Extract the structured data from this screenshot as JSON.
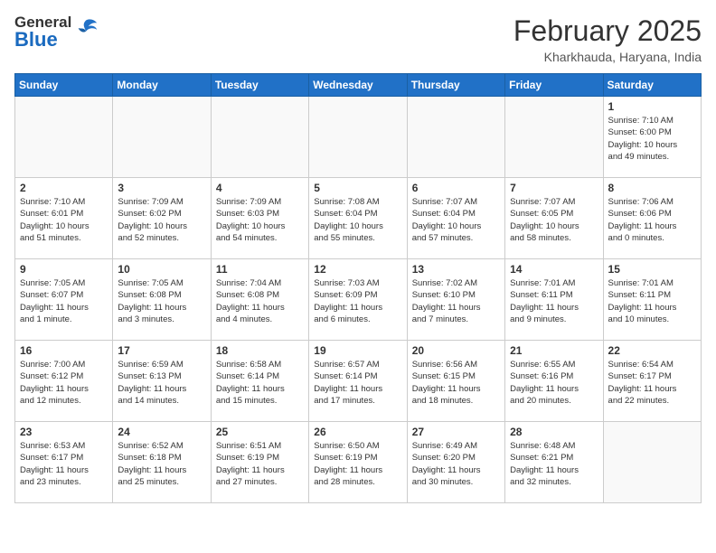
{
  "header": {
    "logo_general": "General",
    "logo_blue": "Blue",
    "month_title": "February 2025",
    "location": "Kharkhauda, Haryana, India"
  },
  "weekdays": [
    "Sunday",
    "Monday",
    "Tuesday",
    "Wednesday",
    "Thursday",
    "Friday",
    "Saturday"
  ],
  "weeks": [
    [
      {
        "day": "",
        "info": ""
      },
      {
        "day": "",
        "info": ""
      },
      {
        "day": "",
        "info": ""
      },
      {
        "day": "",
        "info": ""
      },
      {
        "day": "",
        "info": ""
      },
      {
        "day": "",
        "info": ""
      },
      {
        "day": "1",
        "info": "Sunrise: 7:10 AM\nSunset: 6:00 PM\nDaylight: 10 hours\nand 49 minutes."
      }
    ],
    [
      {
        "day": "2",
        "info": "Sunrise: 7:10 AM\nSunset: 6:01 PM\nDaylight: 10 hours\nand 51 minutes."
      },
      {
        "day": "3",
        "info": "Sunrise: 7:09 AM\nSunset: 6:02 PM\nDaylight: 10 hours\nand 52 minutes."
      },
      {
        "day": "4",
        "info": "Sunrise: 7:09 AM\nSunset: 6:03 PM\nDaylight: 10 hours\nand 54 minutes."
      },
      {
        "day": "5",
        "info": "Sunrise: 7:08 AM\nSunset: 6:04 PM\nDaylight: 10 hours\nand 55 minutes."
      },
      {
        "day": "6",
        "info": "Sunrise: 7:07 AM\nSunset: 6:04 PM\nDaylight: 10 hours\nand 57 minutes."
      },
      {
        "day": "7",
        "info": "Sunrise: 7:07 AM\nSunset: 6:05 PM\nDaylight: 10 hours\nand 58 minutes."
      },
      {
        "day": "8",
        "info": "Sunrise: 7:06 AM\nSunset: 6:06 PM\nDaylight: 11 hours\nand 0 minutes."
      }
    ],
    [
      {
        "day": "9",
        "info": "Sunrise: 7:05 AM\nSunset: 6:07 PM\nDaylight: 11 hours\nand 1 minute."
      },
      {
        "day": "10",
        "info": "Sunrise: 7:05 AM\nSunset: 6:08 PM\nDaylight: 11 hours\nand 3 minutes."
      },
      {
        "day": "11",
        "info": "Sunrise: 7:04 AM\nSunset: 6:08 PM\nDaylight: 11 hours\nand 4 minutes."
      },
      {
        "day": "12",
        "info": "Sunrise: 7:03 AM\nSunset: 6:09 PM\nDaylight: 11 hours\nand 6 minutes."
      },
      {
        "day": "13",
        "info": "Sunrise: 7:02 AM\nSunset: 6:10 PM\nDaylight: 11 hours\nand 7 minutes."
      },
      {
        "day": "14",
        "info": "Sunrise: 7:01 AM\nSunset: 6:11 PM\nDaylight: 11 hours\nand 9 minutes."
      },
      {
        "day": "15",
        "info": "Sunrise: 7:01 AM\nSunset: 6:11 PM\nDaylight: 11 hours\nand 10 minutes."
      }
    ],
    [
      {
        "day": "16",
        "info": "Sunrise: 7:00 AM\nSunset: 6:12 PM\nDaylight: 11 hours\nand 12 minutes."
      },
      {
        "day": "17",
        "info": "Sunrise: 6:59 AM\nSunset: 6:13 PM\nDaylight: 11 hours\nand 14 minutes."
      },
      {
        "day": "18",
        "info": "Sunrise: 6:58 AM\nSunset: 6:14 PM\nDaylight: 11 hours\nand 15 minutes."
      },
      {
        "day": "19",
        "info": "Sunrise: 6:57 AM\nSunset: 6:14 PM\nDaylight: 11 hours\nand 17 minutes."
      },
      {
        "day": "20",
        "info": "Sunrise: 6:56 AM\nSunset: 6:15 PM\nDaylight: 11 hours\nand 18 minutes."
      },
      {
        "day": "21",
        "info": "Sunrise: 6:55 AM\nSunset: 6:16 PM\nDaylight: 11 hours\nand 20 minutes."
      },
      {
        "day": "22",
        "info": "Sunrise: 6:54 AM\nSunset: 6:17 PM\nDaylight: 11 hours\nand 22 minutes."
      }
    ],
    [
      {
        "day": "23",
        "info": "Sunrise: 6:53 AM\nSunset: 6:17 PM\nDaylight: 11 hours\nand 23 minutes."
      },
      {
        "day": "24",
        "info": "Sunrise: 6:52 AM\nSunset: 6:18 PM\nDaylight: 11 hours\nand 25 minutes."
      },
      {
        "day": "25",
        "info": "Sunrise: 6:51 AM\nSunset: 6:19 PM\nDaylight: 11 hours\nand 27 minutes."
      },
      {
        "day": "26",
        "info": "Sunrise: 6:50 AM\nSunset: 6:19 PM\nDaylight: 11 hours\nand 28 minutes."
      },
      {
        "day": "27",
        "info": "Sunrise: 6:49 AM\nSunset: 6:20 PM\nDaylight: 11 hours\nand 30 minutes."
      },
      {
        "day": "28",
        "info": "Sunrise: 6:48 AM\nSunset: 6:21 PM\nDaylight: 11 hours\nand 32 minutes."
      },
      {
        "day": "",
        "info": ""
      }
    ]
  ]
}
